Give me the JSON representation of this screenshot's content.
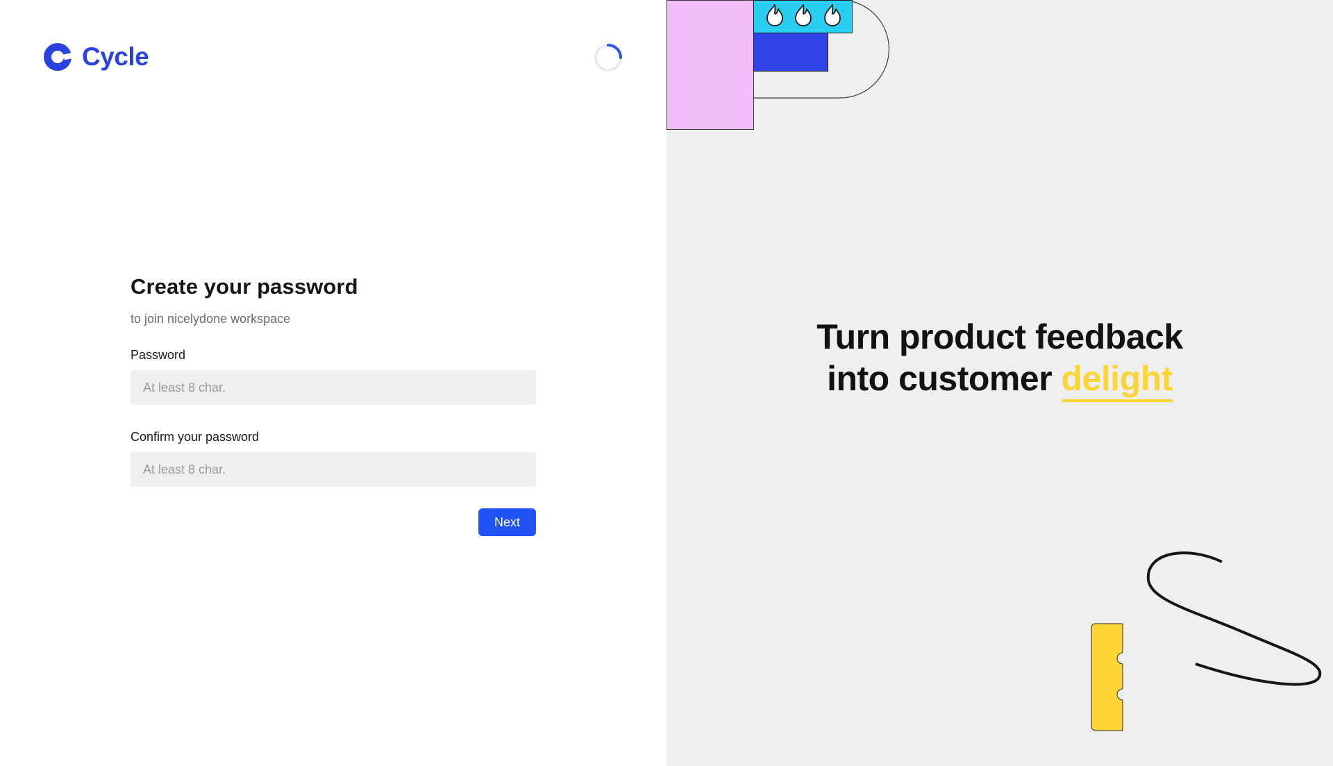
{
  "brand": {
    "name": "Cycle",
    "color": "#2a43e0",
    "logo_icon": "cycle-ring-icon"
  },
  "loading_indicator": "spinner-icon",
  "form": {
    "title": "Create your password",
    "subtitle": "to join nicelydone workspace",
    "password": {
      "label": "Password",
      "placeholder": "At least 8 char.",
      "value": ""
    },
    "confirm_password": {
      "label": "Confirm your password",
      "placeholder": "At least 8 char.",
      "value": ""
    },
    "next_label": "Next",
    "next_color": "#1f53f5"
  },
  "hero": {
    "line1": "Turn product feedback",
    "line2_prefix": "into customer ",
    "line2_accent": "delight",
    "accent_color": "#fcd532",
    "background": "#efefef"
  },
  "decorations": {
    "icons": [
      "flame-icon",
      "flame-icon",
      "flame-icon"
    ],
    "colors": {
      "pink": "#f2bef9",
      "cyan": "#28cdf0",
      "blue": "#3043e8",
      "yellow": "#fcd532"
    }
  }
}
